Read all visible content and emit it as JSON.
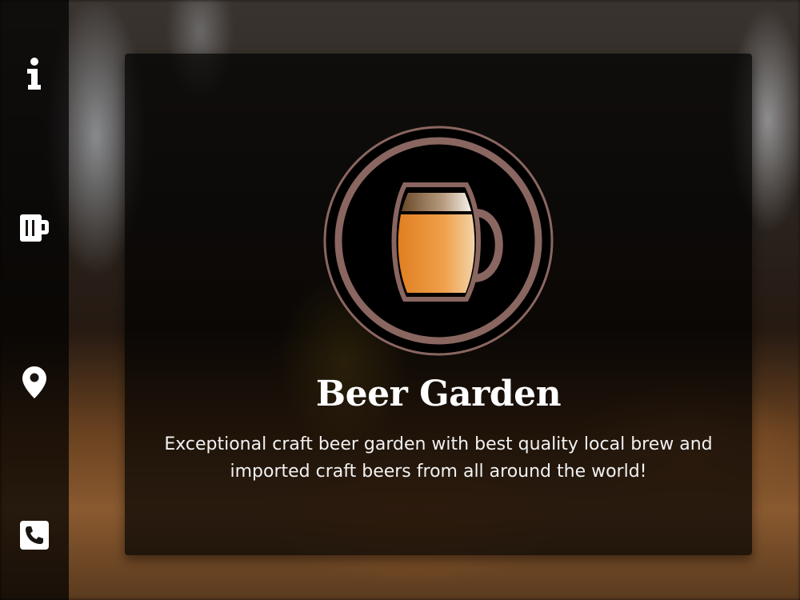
{
  "hero": {
    "title": "Beer Garden",
    "description": "Exceptional craft beer garden with best quality local brew and imported craft beers from all around the world!"
  },
  "sidebar": {
    "items": [
      {
        "name": "info",
        "icon": "info-icon"
      },
      {
        "name": "beer-menu",
        "icon": "beer-mug-icon"
      },
      {
        "name": "location",
        "icon": "map-marker-icon"
      },
      {
        "name": "contact",
        "icon": "phone-icon"
      }
    ]
  },
  "logo": {
    "icon": "beer-mug-logo"
  },
  "colors": {
    "accent": "#8a6660",
    "beer": "#e8922e",
    "foam": "#e8e4df",
    "sidebar_bg": "#000000",
    "text": "#ffffff"
  }
}
